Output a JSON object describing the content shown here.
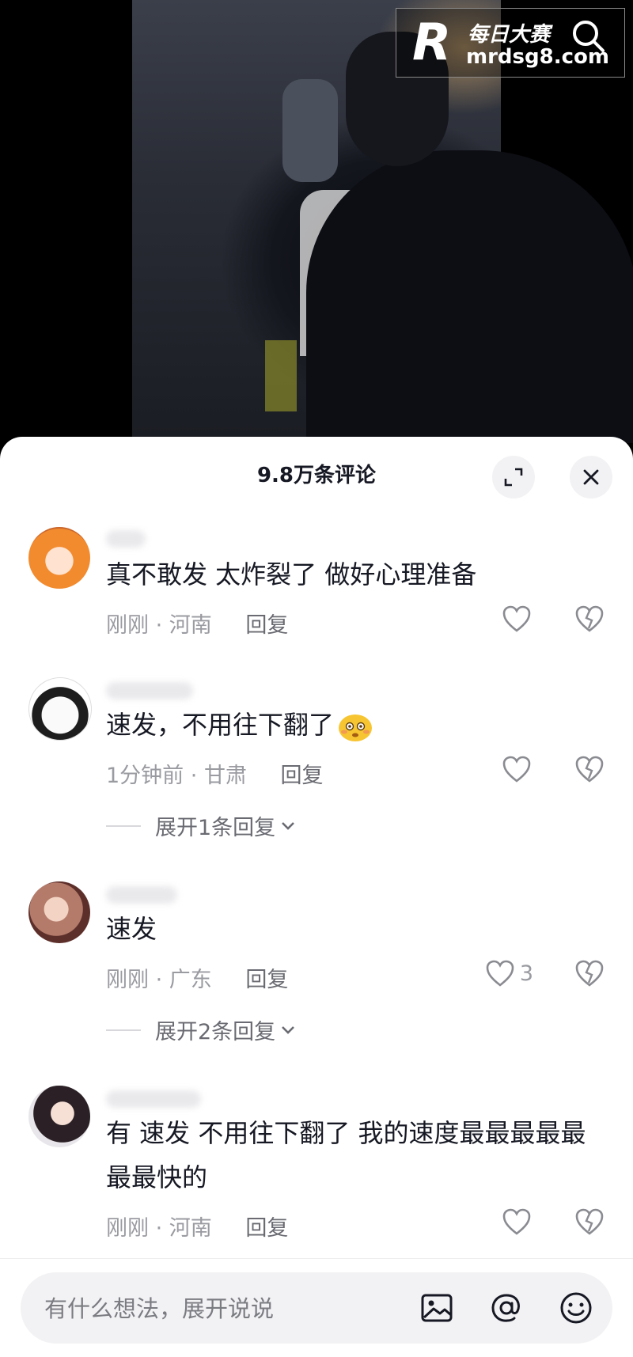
{
  "watermark": {
    "brand_cn": "每日大赛",
    "brand_en": "mrdsg8.com",
    "logo_letter": "R"
  },
  "sheet": {
    "title": "9.8万条评论"
  },
  "comments": [
    {
      "text": "真不敢发 太炸裂了 做好心理准备",
      "time": "刚刚",
      "location": "河南",
      "reply": "回复",
      "likes": ""
    },
    {
      "text": "速发，不用往下翻了",
      "emoji": "flushed-face-emoji",
      "time": "1分钟前",
      "location": "甘肃",
      "reply": "回复",
      "likes": "",
      "expand": "展开1条回复"
    },
    {
      "text": "速发",
      "time": "刚刚",
      "location": "广东",
      "reply": "回复",
      "likes": "3",
      "expand": "展开2条回复"
    },
    {
      "text": "有 速发 不用往下翻了 我的速度最最最最最最最快的",
      "time": "刚刚",
      "location": "河南",
      "reply": "回复",
      "likes": ""
    }
  ],
  "input": {
    "placeholder": "有什么想法，展开说说"
  },
  "icons": {
    "video_search": "search-icon",
    "expand_sheet": "expand-icon",
    "close_sheet": "close-icon",
    "like": "heart-icon",
    "dislike": "broken-heart-icon",
    "image": "image-icon",
    "mention": "at-icon",
    "emoji": "emoji-icon"
  },
  "colors": {
    "text": "#161823",
    "muted": "#9a9ba1",
    "sheet_bg": "#ffffff",
    "input_bg": "#f2f2f4"
  }
}
